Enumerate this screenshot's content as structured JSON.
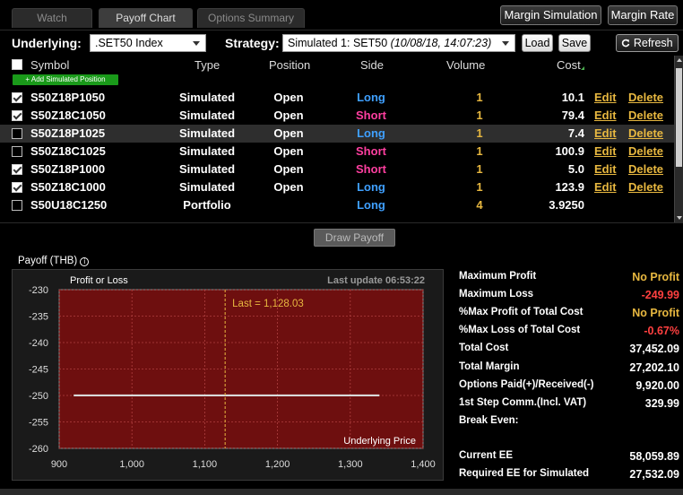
{
  "tabs": [
    {
      "label": "Watch",
      "active": false
    },
    {
      "label": "Payoff Chart",
      "active": true
    },
    {
      "label": "Options Summary",
      "active": false
    }
  ],
  "top_buttons": {
    "margin_simulation": "Margin Simulation",
    "margin_rate": "Margin Rate"
  },
  "controls": {
    "underlying_label": "Underlying:",
    "underlying_value": ".SET50 Index",
    "strategy_label": "Strategy:",
    "strategy_value": "Simulated 1: SET50",
    "strategy_time": "(10/08/18, 14:07:23)",
    "load": "Load",
    "save": "Save",
    "refresh": "Refresh",
    "refresh_icon": "refresh-icon"
  },
  "table": {
    "headers": {
      "symbol": "Symbol",
      "type": "Type",
      "position": "Position",
      "side": "Side",
      "volume": "Volume",
      "cost": "Cost"
    },
    "add_button": "+ Add Simulated Position",
    "edit_label": "Edit",
    "delete_label": "Delete",
    "rows": [
      {
        "checked": true,
        "symbol": "S50Z18P1050",
        "type": "Simulated",
        "position": "Open",
        "side": "Long",
        "volume": "1",
        "cost": "10.1"
      },
      {
        "checked": true,
        "symbol": "S50Z18C1050",
        "type": "Simulated",
        "position": "Open",
        "side": "Short",
        "volume": "1",
        "cost": "79.4"
      },
      {
        "checked": false,
        "symbol": "S50Z18P1025",
        "type": "Simulated",
        "position": "Open",
        "side": "Long",
        "volume": "1",
        "cost": "7.4",
        "selected": true
      },
      {
        "checked": false,
        "symbol": "S50Z18C1025",
        "type": "Simulated",
        "position": "Open",
        "side": "Short",
        "volume": "1",
        "cost": "100.9"
      },
      {
        "checked": true,
        "symbol": "S50Z18P1000",
        "type": "Simulated",
        "position": "Open",
        "side": "Short",
        "volume": "1",
        "cost": "5.0"
      },
      {
        "checked": true,
        "symbol": "S50Z18C1000",
        "type": "Simulated",
        "position": "Open",
        "side": "Long",
        "volume": "1",
        "cost": "123.9"
      },
      {
        "checked": false,
        "symbol": "S50U18C1250",
        "type": "Portfolio",
        "position": "",
        "side": "Long",
        "volume": "4",
        "cost": "3.9250",
        "portfolio": true
      }
    ]
  },
  "draw_payoff": "Draw Payoff",
  "payoff": {
    "title": "Payoff (THB)",
    "info_icon": "info-icon",
    "last_update": "Last update 06:53:22"
  },
  "chart_data": {
    "type": "line",
    "title": "",
    "ylabel": "Profit or Loss",
    "xlabel": "Underlying Price",
    "xlim": [
      900,
      1400
    ],
    "ylim": [
      -260,
      -230
    ],
    "xticks": [
      900,
      1000,
      1100,
      1200,
      1300,
      1400
    ],
    "yticks": [
      -230,
      -235,
      -240,
      -245,
      -250,
      -255,
      -260
    ],
    "xtick_labels": [
      "900",
      "1,000",
      "1,100",
      "1,200",
      "1,300",
      "1,400"
    ],
    "ytick_labels": [
      "-230",
      "-235",
      "-240",
      "-245",
      "-250",
      "-255",
      "-260"
    ],
    "grid": true,
    "background_color": "#6e0f0f",
    "series": [
      {
        "x": [
          920,
          1340
        ],
        "y": [
          -249.99,
          -249.99
        ],
        "color": "#d9d9d9"
      }
    ],
    "marker": {
      "x": 1128.03,
      "label": "Last = 1,128.03",
      "color": "#e8b840"
    }
  },
  "stats": [
    {
      "label": "Maximum Profit",
      "value": "No Profit",
      "style": "warn"
    },
    {
      "label": "Maximum Loss",
      "value": "-249.99",
      "style": "neg"
    },
    {
      "label": "%Max Profit of Total Cost",
      "value": "No Profit",
      "style": "warn"
    },
    {
      "label": "%Max Loss of Total Cost",
      "value": "-0.67%",
      "style": "neg"
    },
    {
      "label": "Total Cost",
      "value": "37,452.09",
      "style": ""
    },
    {
      "label": "Total Margin",
      "value": "27,202.10",
      "style": ""
    },
    {
      "label": "Options Paid(+)/Received(-)",
      "value": "9,920.00",
      "style": ""
    },
    {
      "label": "1st Step Comm.(Incl. VAT)",
      "value": "329.99",
      "style": ""
    },
    {
      "label": "Break Even:",
      "value": "",
      "style": ""
    },
    {
      "label": "Current EE",
      "value": "58,059.89",
      "style": ""
    },
    {
      "label": "Required EE for Simulated",
      "value": "27,532.09",
      "style": ""
    }
  ]
}
